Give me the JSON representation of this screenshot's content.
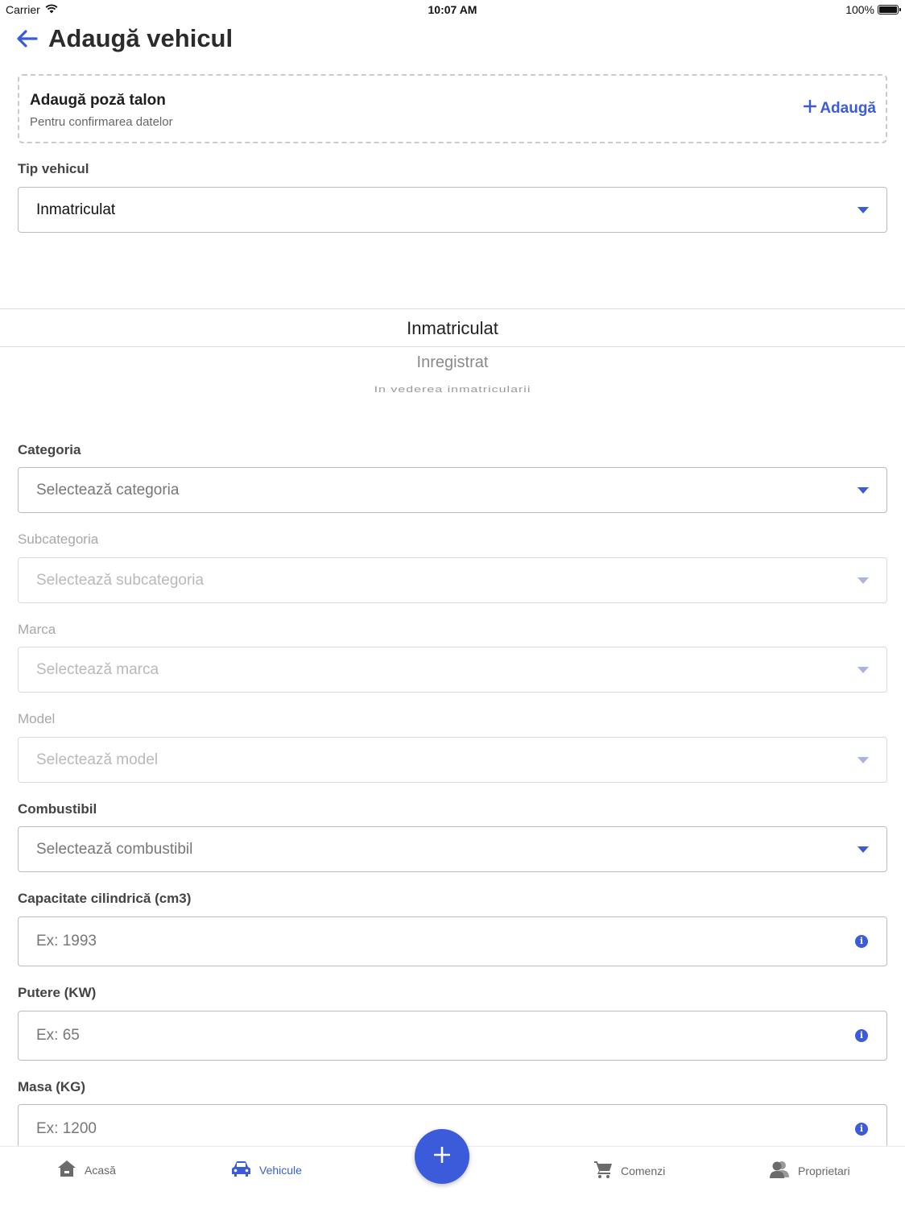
{
  "status_bar": {
    "carrier": "Carrier",
    "time": "10:07 AM",
    "battery": "100%"
  },
  "header": {
    "title": "Adaugă vehicul"
  },
  "photo_card": {
    "title": "Adaugă poză talon",
    "subtitle": "Pentru confirmarea datelor",
    "add_label": "Adaugă"
  },
  "form": {
    "tip_vehicul": {
      "label": "Tip vehicul",
      "value": "Inmatriculat"
    },
    "picker": {
      "selected": "Inmatriculat",
      "options": [
        "Inregistrat",
        "In vederea inmatricularii"
      ]
    },
    "categoria": {
      "label": "Categoria",
      "placeholder": "Selectează categoria"
    },
    "subcategoria": {
      "label": "Subcategoria",
      "placeholder": "Selectează subcategoria"
    },
    "marca": {
      "label": "Marca",
      "placeholder": "Selectează marca"
    },
    "model": {
      "label": "Model",
      "placeholder": "Selectează model"
    },
    "combustibil": {
      "label": "Combustibil",
      "placeholder": "Selectează combustibil"
    },
    "capacitate": {
      "label": "Capacitate cilindrică (cm3)",
      "placeholder": "Ex: 1993"
    },
    "putere": {
      "label": "Putere (KW)",
      "placeholder": "Ex: 65"
    },
    "masa": {
      "label": "Masa (KG)",
      "placeholder": "Ex: 1200"
    }
  },
  "tabbar": {
    "items": [
      {
        "label": "Acasă",
        "icon": "home-icon",
        "active": false
      },
      {
        "label": "Vehicule",
        "icon": "car-icon",
        "active": true
      },
      {
        "label": "Comenzi",
        "icon": "cart-icon",
        "active": false
      },
      {
        "label": "Proprietari",
        "icon": "users-icon",
        "active": false
      }
    ],
    "fab_icon": "plus-icon"
  },
  "colors": {
    "accent": "#3b5bdb",
    "border": "#b9bcc3",
    "disabled_border": "#d8dadf"
  }
}
